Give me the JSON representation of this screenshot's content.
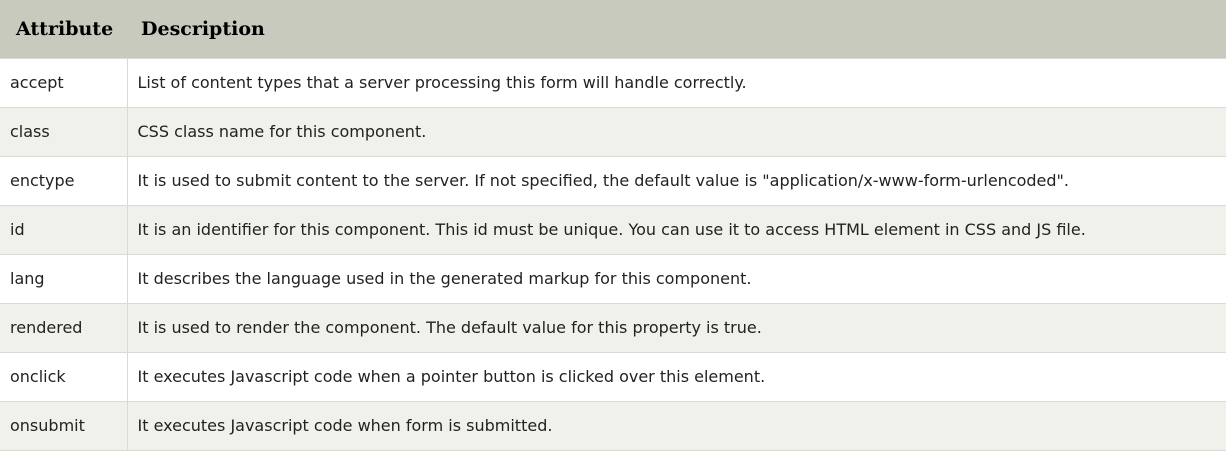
{
  "table": {
    "headers": {
      "attribute": "Attribute",
      "description": "Description"
    },
    "rows": [
      {
        "attribute": "accept",
        "description": "List of content types that a server processing this form will handle correctly."
      },
      {
        "attribute": "class",
        "description": "CSS class name for this component."
      },
      {
        "attribute": "enctype",
        "description": "It is used to submit content to the server. If not specified, the default value is \"application/x-www-form-urlencoded\"."
      },
      {
        "attribute": "id",
        "description": "It is an identifier for this component. This id must be unique. You can use it to access HTML element in CSS and JS file."
      },
      {
        "attribute": "lang",
        "description": "It describes the language used in the generated markup for this component."
      },
      {
        "attribute": "rendered",
        "description": "It is used to render the component. The default value for this property is true."
      },
      {
        "attribute": "onclick",
        "description": "It executes Javascript code when a pointer button is clicked over this element."
      },
      {
        "attribute": "onsubmit",
        "description": "It executes Javascript code when form is submitted."
      }
    ]
  },
  "colors": {
    "header_bg": "#c7cabd",
    "row_alt_bg": "#eff1ea",
    "border": "#d8dad3"
  }
}
